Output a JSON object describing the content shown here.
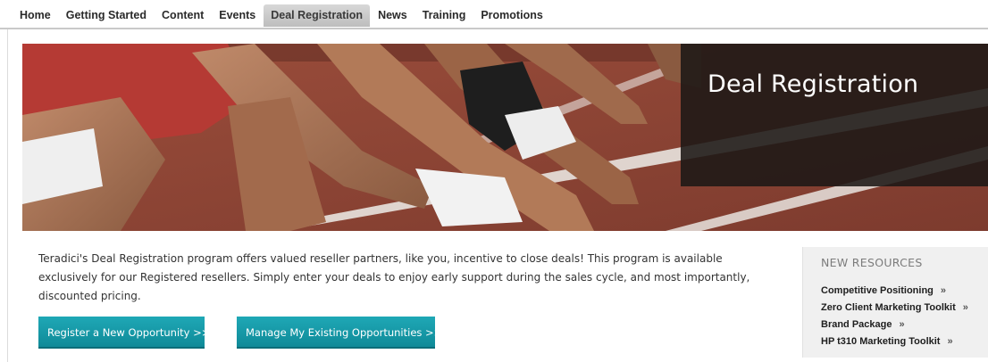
{
  "nav": {
    "items": [
      {
        "label": "Home",
        "active": false
      },
      {
        "label": "Getting Started",
        "active": false
      },
      {
        "label": "Content",
        "active": false
      },
      {
        "label": "Events",
        "active": false
      },
      {
        "label": "Deal Registration",
        "active": true
      },
      {
        "label": "News",
        "active": false
      },
      {
        "label": "Training",
        "active": false
      },
      {
        "label": "Promotions",
        "active": false
      }
    ]
  },
  "hero": {
    "title": "Deal Registration"
  },
  "intro": {
    "text": "Teradici's Deal Registration program offers valued reseller partners, like you, incentive to close deals! This program is available exclusively for our Registered resellers. Simply enter your deals to enjoy early support during the sales cycle, and most importantly, discounted pricing."
  },
  "buttons": {
    "register": "Register a New Opportunity >>",
    "manage": "Manage My Existing Opportunities >>"
  },
  "resources": {
    "title": "NEW RESOURCES",
    "arrow": "»",
    "items": [
      "Competitive Positioning",
      "Zero Client Marketing Toolkit",
      "Brand Package",
      "HP t310 Marketing Toolkit"
    ]
  },
  "colors": {
    "accent": "#1399a7",
    "track": "#8e4636",
    "title_box": "#1c1816"
  },
  "icons": {
    "resource_arrow": "double-chevron-right-icon"
  }
}
